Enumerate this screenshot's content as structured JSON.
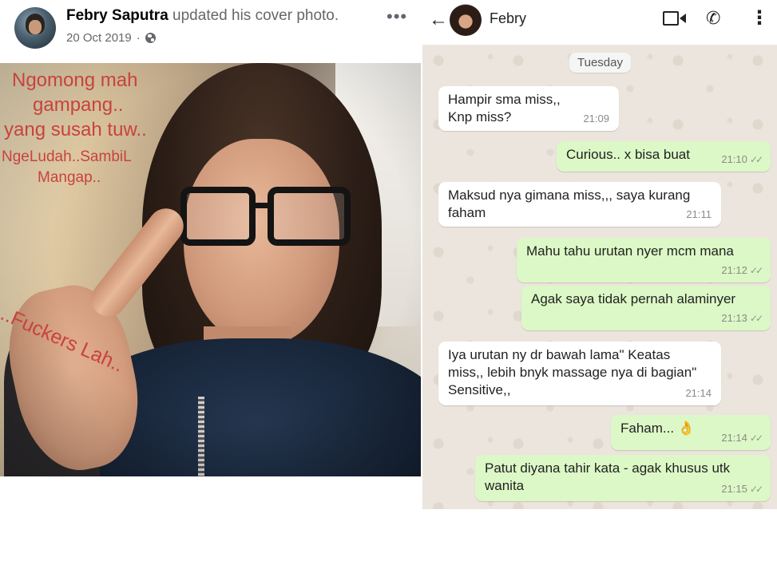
{
  "facebook_post": {
    "author": "Febry Saputra",
    "action": "updated his cover photo.",
    "date": "20 Oct 2019",
    "separator": "·",
    "privacy_icon": "globe-icon",
    "more_icon": "more-icon",
    "more_glyph": "•••",
    "overlay_text": {
      "line1": "Ngomong mah",
      "line2": "gampang..",
      "line3": "yang susah tuw..",
      "line4": "NgeLudah..SambiL",
      "line5": "Mangap..",
      "line6": "..Fuckers Lah.."
    }
  },
  "whatsapp_chat": {
    "contact_name": "Febry",
    "back_glyph": "←",
    "phone_glyph": "✆",
    "menu_glyph": "⋮",
    "day_label": "Tuesday",
    "read_tick": "✓✓",
    "messages": [
      {
        "direction": "in",
        "text": "Hampir sma miss,,\nKnp miss?",
        "time": "21:09"
      },
      {
        "direction": "out",
        "text": "Curious.. x bisa buat",
        "time": "21:10"
      },
      {
        "direction": "in",
        "text": "Maksud nya gimana miss,,, saya kurang\nfaham",
        "time": "21:11"
      },
      {
        "direction": "out",
        "text": "Mahu tahu urutan nyer mcm mana",
        "time": "21:12"
      },
      {
        "direction": "out",
        "text": "Agak saya tidak pernah alaminyer",
        "time": "21:13"
      },
      {
        "direction": "in",
        "text": "Iya urutan ny dr bawah lama\" Keatas\nmiss,, lebih bnyk massage nya di bagian\"\nSensitive,,",
        "time": "21:14"
      },
      {
        "direction": "out",
        "text": "Faham... 👌",
        "time": "21:14"
      },
      {
        "direction": "out",
        "text": "Patut diyana tahir kata - agak khusus utk\nwanita",
        "time": "21:15"
      }
    ]
  },
  "colors": {
    "overlay_text": "#c8433d",
    "incoming_bubble": "#ffffff",
    "outgoing_bubble": "#dcf8c6",
    "chat_background": "#ece5dd"
  }
}
